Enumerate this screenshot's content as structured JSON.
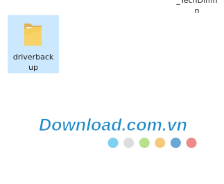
{
  "desktop": {
    "partial_item_label": "_TechDiffin n",
    "folder_item": {
      "icon": "folder-icon",
      "label": "driverback up",
      "selected": true
    }
  },
  "watermark": {
    "logo_text": "Download.com.vn",
    "dot_colors": [
      "#7fd0f0",
      "#dddddd",
      "#b9e08a",
      "#f5c97b",
      "#6aa6d6",
      "#f08a8a"
    ]
  }
}
